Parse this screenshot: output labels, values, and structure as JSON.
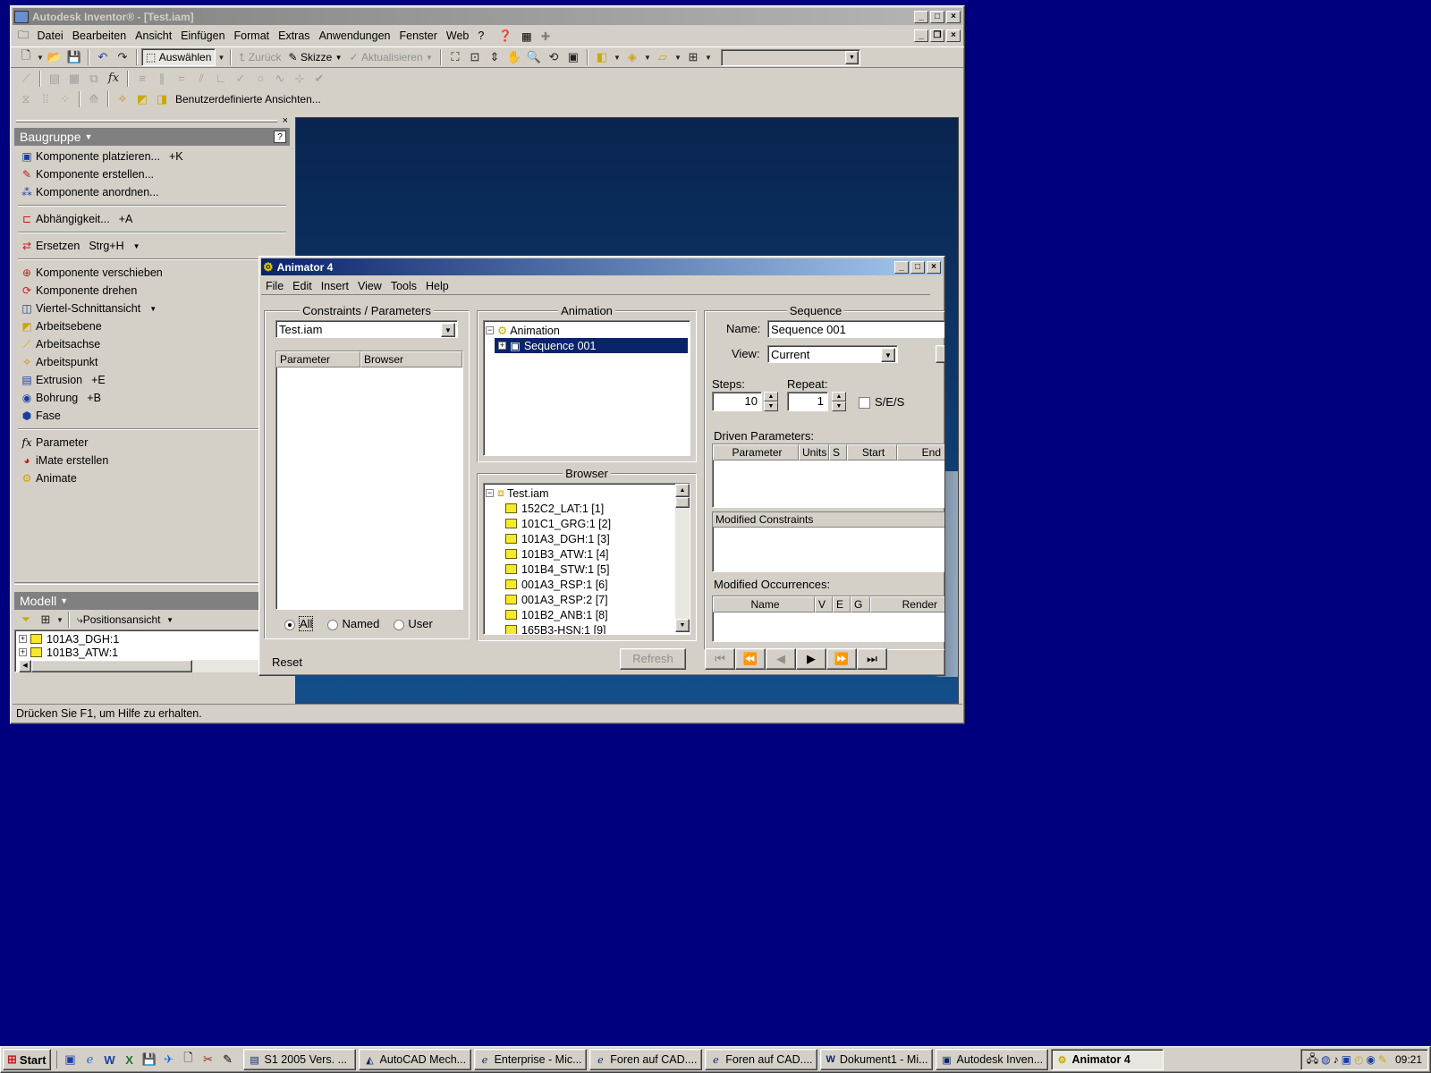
{
  "inventor": {
    "title": "Autodesk Inventor® - [Test.iam]",
    "menu": [
      "Datei",
      "Bearbeiten",
      "Ansicht",
      "Einfügen",
      "Format",
      "Extras",
      "Anwendungen",
      "Fenster",
      "Web",
      "?"
    ],
    "toolbar": {
      "select_label": "Auswählen",
      "back_label": "Zurück",
      "sketch_label": "Skizze",
      "update_label": "Aktualisieren",
      "custom_views_label": "Benutzerdefinierte Ansichten..."
    },
    "panel": {
      "title": "Baugruppe",
      "items": [
        {
          "label": "Komponente platzieren...",
          "key": "+K"
        },
        {
          "label": "Komponente erstellen...",
          "key": ""
        },
        {
          "label": "Komponente anordnen...",
          "key": ""
        },
        {
          "label": "Abhängigkeit...",
          "key": "+A"
        },
        {
          "label": "Ersetzen",
          "key": "Strg+H"
        },
        {
          "label": "Komponente verschieben",
          "key": ""
        },
        {
          "label": "Komponente drehen",
          "key": ""
        },
        {
          "label": "Viertel-Schnittansicht",
          "key": ""
        },
        {
          "label": "Arbeitsebene",
          "key": ""
        },
        {
          "label": "Arbeitsachse",
          "key": ""
        },
        {
          "label": "Arbeitspunkt",
          "key": ""
        },
        {
          "label": "Extrusion",
          "key": "+E"
        },
        {
          "label": "Bohrung",
          "key": "+B"
        },
        {
          "label": "Fase",
          "key": ""
        },
        {
          "label": "Parameter",
          "key": ""
        },
        {
          "label": "iMate erstellen",
          "key": ""
        },
        {
          "label": "Animate",
          "key": ""
        }
      ]
    },
    "model": {
      "title": "Modell",
      "view_label": "Positionsansicht",
      "items": [
        "101A3_DGH:1",
        "101B3_ATW:1"
      ]
    },
    "status": "Drücken Sie F1, um Hilfe zu erhalten."
  },
  "animator": {
    "title": "Animator 4",
    "menu": [
      "File",
      "Edit",
      "Insert",
      "View",
      "Tools",
      "Help"
    ],
    "constraints": {
      "group_label": "Constraints / Parameters",
      "combo_value": "Test.iam",
      "col_parameter": "Parameter",
      "col_browser": "Browser",
      "radio_all": "All",
      "radio_named": "Named",
      "radio_user": "User"
    },
    "animation": {
      "group_label": "Animation",
      "root": "Animation",
      "sequence": "Sequence 001"
    },
    "browser": {
      "group_label": "Browser",
      "root": "Test.iam",
      "items": [
        "152C2_LAT:1 [1]",
        "101C1_GRG:1 [2]",
        "101A3_DGH:1 [3]",
        "101B3_ATW:1 [4]",
        "101B4_STW:1 [5]",
        "001A3_RSP:1 [6]",
        "001A3_RSP:2 [7]",
        "101B2_ANB:1 [8]",
        "165B3-HSN:1 [9]"
      ]
    },
    "sequence": {
      "group_label": "Sequence",
      "name_label": "Name:",
      "name_value": "Sequence 001",
      "view_label": "View:",
      "view_value": "Current",
      "steps_label": "Steps:",
      "steps_value": "10",
      "repeat_label": "Repeat:",
      "repeat_value": "1",
      "ses_label": "S/E/S",
      "driven_label": "Driven Parameters:",
      "driven_cols": [
        "Parameter",
        "Units",
        "S",
        "Start",
        "End"
      ],
      "modified_constraints_label": "Modified Constraints",
      "modified_occurrences_label": "Modified Occurrences:",
      "occ_cols": [
        "Name",
        "V",
        "E",
        "G",
        "Render"
      ]
    },
    "reset_label": "Reset",
    "refresh_label": "Refresh"
  },
  "taskbar": {
    "start_label": "Start",
    "tasks": [
      "S1 2005 Vers. ...",
      "AutoCAD Mech...",
      "Enterprise - Mic...",
      "Foren auf CAD....",
      "Foren auf CAD....",
      "Dokument1 - Mi...",
      "Autodesk Inven...",
      "Animator 4"
    ],
    "clock": "09:21"
  }
}
